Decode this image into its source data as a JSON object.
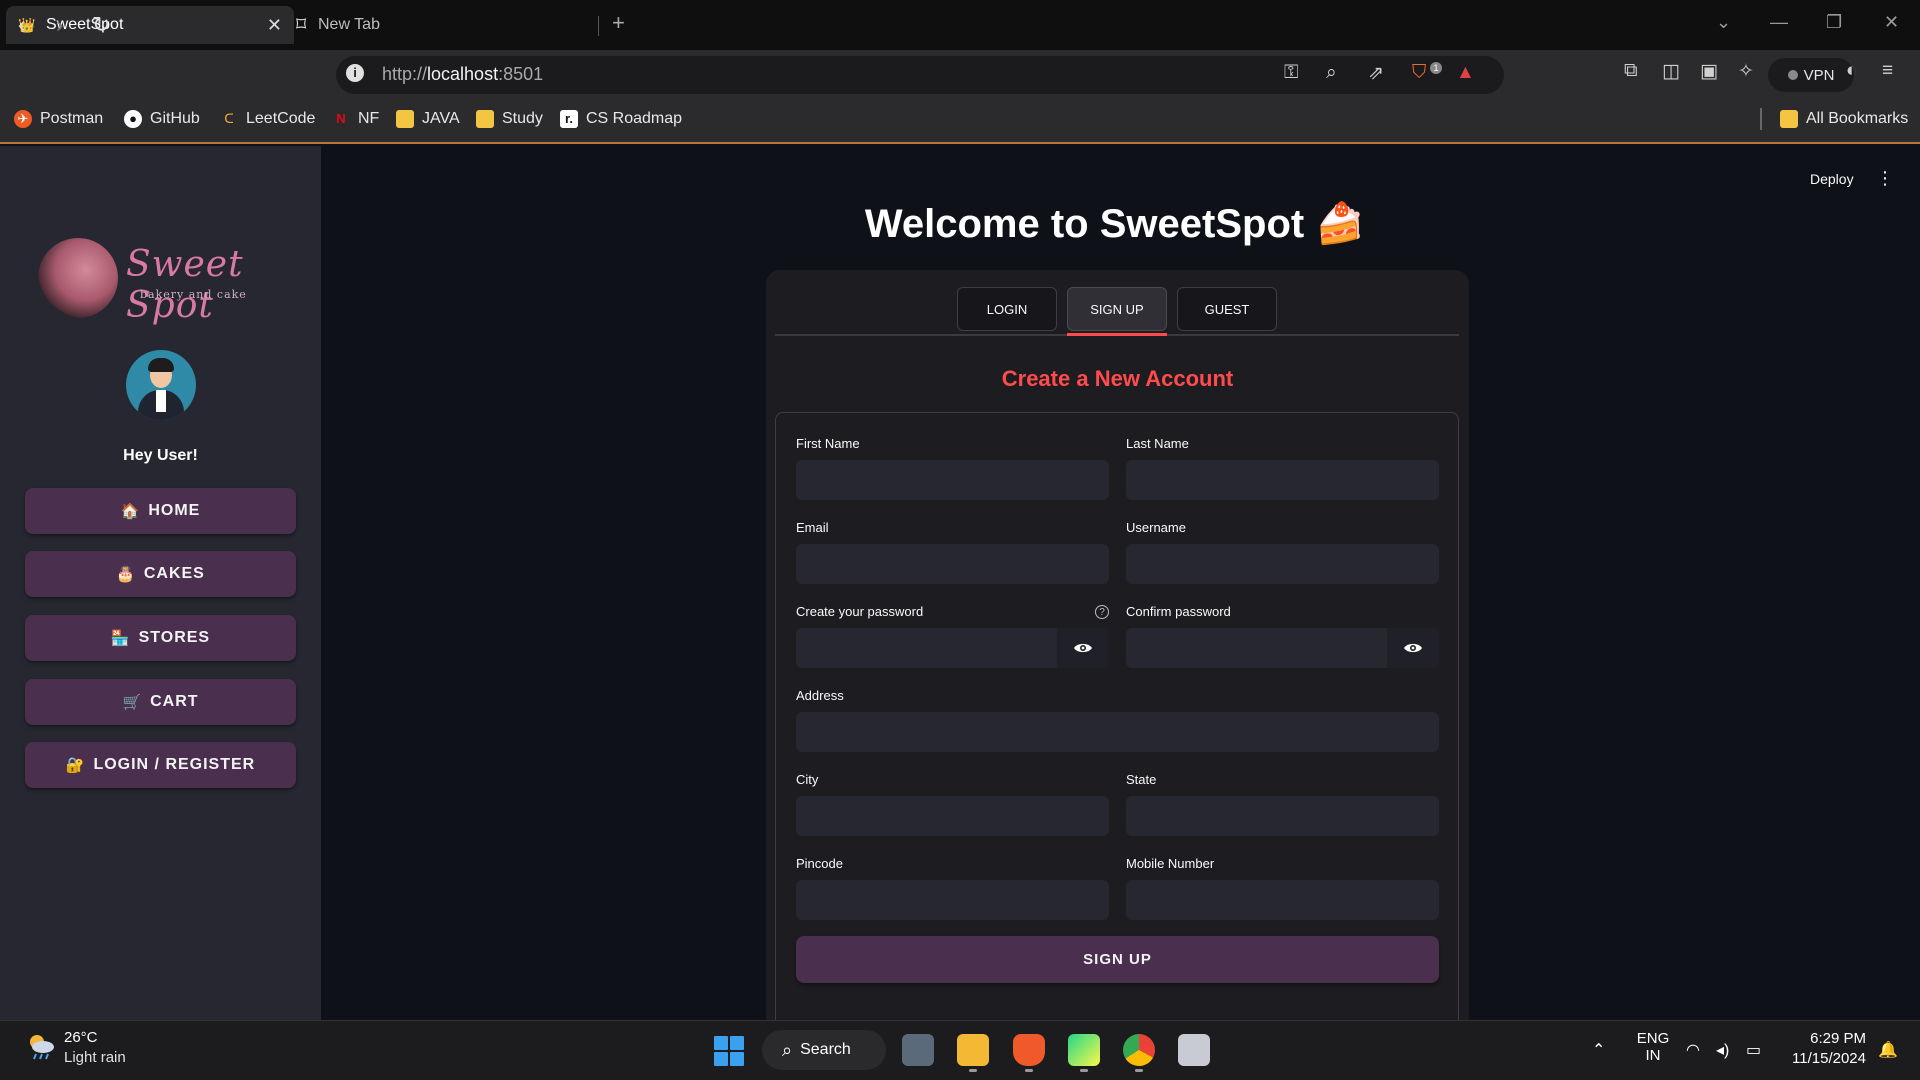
{
  "browser": {
    "tabs": [
      {
        "title": "SweetSpot"
      },
      {
        "title": "New Tab"
      }
    ],
    "url_prefix": "http://",
    "url_host": "localhost",
    "url_port": ":8501",
    "vpn_label": "VPN",
    "brave_badge": "1",
    "bookmarks": [
      {
        "label": "Postman",
        "icon": "postman-icon"
      },
      {
        "label": "GitHub",
        "icon": "github-icon"
      },
      {
        "label": "LeetCode",
        "icon": "leetcode-icon"
      },
      {
        "label": "NF",
        "icon": "netflix-icon"
      },
      {
        "label": "JAVA",
        "icon": "folder-icon"
      },
      {
        "label": "Study",
        "icon": "folder-icon"
      },
      {
        "label": "CS Roadmap",
        "icon": "roadmap-icon"
      }
    ],
    "all_bookmarks": "All Bookmarks"
  },
  "sidebar": {
    "logo_text": "Sweet Spot",
    "logo_subtext": "bakery and cake",
    "greeting": "Hey User!",
    "items": [
      {
        "label": "HOME",
        "emoji": "🏠"
      },
      {
        "label": "CAKES",
        "emoji": "🎂"
      },
      {
        "label": "STORES",
        "emoji": "🏪"
      },
      {
        "label": "CART",
        "emoji": "🛒"
      },
      {
        "label": "LOGIN / REGISTER",
        "emoji": "🔐"
      }
    ]
  },
  "header": {
    "deploy": "Deploy",
    "title": "Welcome to SweetSpot 🍰"
  },
  "tabs": [
    {
      "label": "LOGIN"
    },
    {
      "label": "SIGN UP"
    },
    {
      "label": "GUEST"
    }
  ],
  "form": {
    "subtitle": "Create a New Account",
    "first_name": {
      "label": "First Name",
      "value": ""
    },
    "last_name": {
      "label": "Last Name",
      "value": ""
    },
    "email": {
      "label": "Email",
      "value": ""
    },
    "username": {
      "label": "Username",
      "value": ""
    },
    "password": {
      "label": "Create your password",
      "value": ""
    },
    "confirm_password": {
      "label": "Confirm password",
      "value": ""
    },
    "address": {
      "label": "Address",
      "value": ""
    },
    "city": {
      "label": "City",
      "value": ""
    },
    "state": {
      "label": "State",
      "value": ""
    },
    "pincode": {
      "label": "Pincode",
      "value": ""
    },
    "mobile": {
      "label": "Mobile Number",
      "value": ""
    },
    "submit": "SIGN UP"
  },
  "taskbar": {
    "temperature": "26°C",
    "weather": "Light rain",
    "search": "Search",
    "lang1": "ENG",
    "lang2": "IN",
    "time": "6:29 PM",
    "date": "11/15/2024"
  },
  "colors": {
    "accent": "#ff4b4b",
    "nav_button": "#4a2f4f",
    "sidebar_bg": "#262730",
    "main_bg": "#0e1117"
  }
}
